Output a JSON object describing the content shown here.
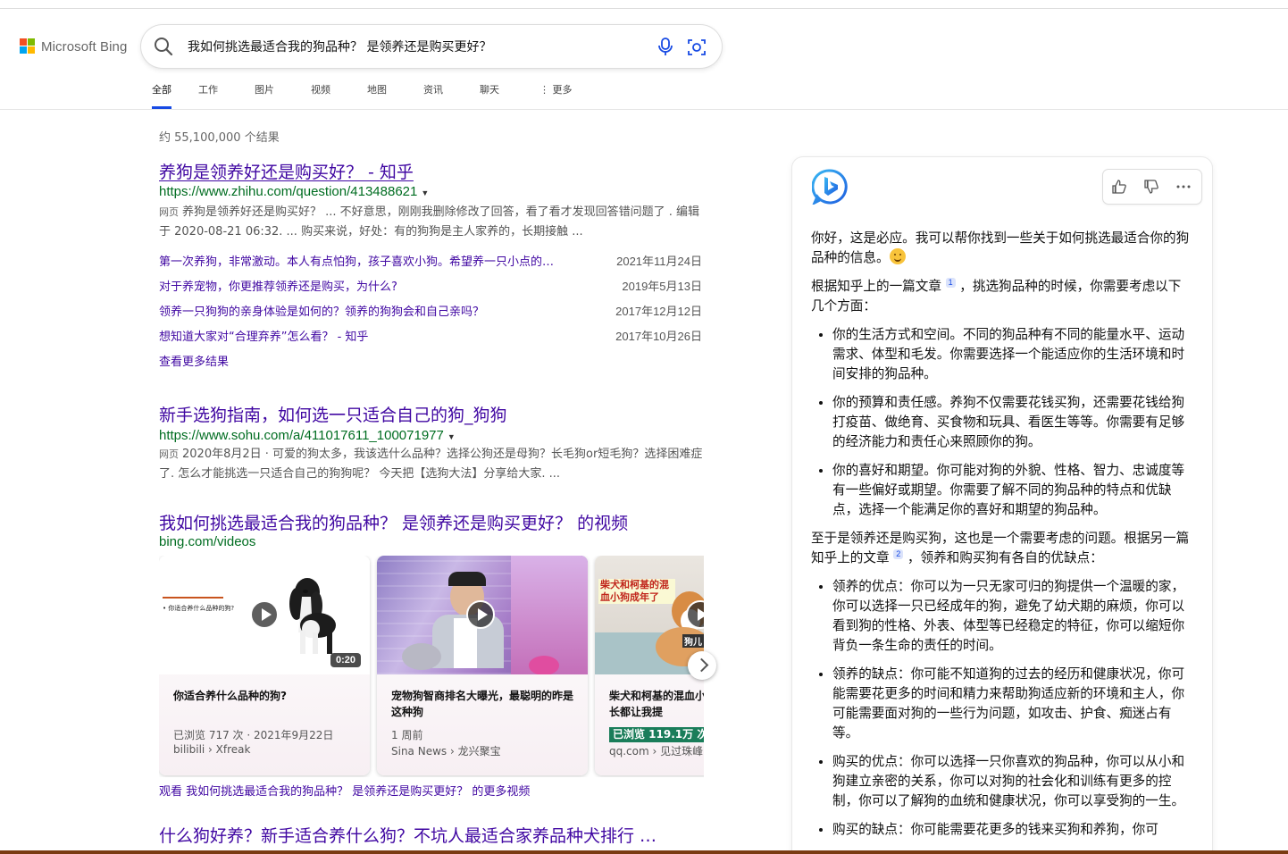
{
  "brand": {
    "name": "Microsoft Bing",
    "colors": [
      "#f25022",
      "#7fba00",
      "#00a4ef",
      "#ffb900"
    ]
  },
  "search": {
    "query": "我如何挑选最适合我的狗品种？ 是领养还是购买更好？",
    "icons": [
      "search-icon",
      "microphone-icon",
      "visual-search-icon"
    ]
  },
  "tabs": [
    {
      "label": "全部",
      "active": true
    },
    {
      "label": "工作"
    },
    {
      "label": "图片"
    },
    {
      "label": "视频"
    },
    {
      "label": "地图"
    },
    {
      "label": "资讯"
    },
    {
      "label": "聊天"
    },
    {
      "label": "⋮ 更多"
    }
  ],
  "results_count": "约 55,100,000 个结果",
  "results": [
    {
      "title": "养狗是领养好还是购买好？ - 知乎",
      "url": "https://www.zhihu.com/question/413488621",
      "label": "网页",
      "snippet": "养狗是领养好还是购买好？ ... 不好意思，刚刚我删除修改了回答，看了看才发现回答错问题了 . 编辑于 2020-08-21 06:32. ... 购买来说，好处：有的狗狗是主人家养的，长期接触 ...",
      "deep_links": [
        {
          "text": "第一次养狗，非常激动。本人有点怕狗，孩子喜欢小狗。希望养一只小点的…",
          "date": "2021年11月24日"
        },
        {
          "text": "对于养宠物，你更推荐领养还是购买，为什么?",
          "date": "2019年5月13日"
        },
        {
          "text": "领养一只狗狗的亲身体验是如何的？领养的狗狗会和自己亲吗？",
          "date": "2017年12月12日"
        },
        {
          "text": "想知道大家对“合理弃养”怎么看？ - 知乎",
          "date": "2017年10月26日"
        }
      ],
      "more": "查看更多结果"
    },
    {
      "title": "新手选狗指南，如何选一只适合自己的狗_狗狗",
      "url": "https://www.sohu.com/a/411017611_100071977",
      "label": "网页",
      "snippet": "2020年8月2日 · 可爱的狗太多，我该选什么品种？选择公狗还是母狗？长毛狗or短毛狗？选择困难症了. 怎么才能挑选一只适合自己的狗狗呢？ 今天把【选狗大法】分享给大家. ..."
    }
  ],
  "videos": {
    "title": "我如何挑选最适合我的狗品种？ 是领养还是购买更好？ 的视频",
    "source": "bing.com/videos",
    "items": [
      {
        "thumb_caption": "• 你适合养什么品种的狗?",
        "duration": "0:20",
        "title": "你适合养什么品种的狗?",
        "meta": "已浏览 717 次 · 2021年9月22日",
        "source": "bilibili › Xfreak"
      },
      {
        "title": "宠物狗智商排名大曝光，最聪明的昨是这种狗",
        "meta": "1 周前",
        "source": "Sina News › 龙兴聚宝"
      },
      {
        "thumb_caption": "柴犬和柯基的混血小狗成年了",
        "thumb_caption2": "狗儿",
        "title": "柴犬和柯基的混血小狗长大了，一次成长都让我提",
        "meta": "已浏览 119.1万 次",
        "source": "qq.com › 见过珠峰"
      }
    ],
    "see_more": "观看 我如何挑选最适合我的狗品种？ 是领养还是购买更好？ 的更多视频"
  },
  "result3_title": "什么狗好养？新手适合养什么狗？不坑人最适合家养品种犬排行 …",
  "chat": {
    "greeting": "你好，这是必应。我可以帮你找到一些关于如何挑选最适合你的狗品种的信息。",
    "intro1_before": "根据知乎上的一篇文章",
    "cite1": "1",
    "intro1_after": "，挑选狗品种的时候，你需要考虑以下几个方面：",
    "points1": [
      "你的生活方式和空间。不同的狗品种有不同的能量水平、运动需求、体型和毛发。你需要选择一个能适应你的生活环境和时间安排的狗品种。",
      "你的预算和责任感。养狗不仅需要花钱买狗，还需要花钱给狗打疫苗、做绝育、买食物和玩具、看医生等等。你需要有足够的经济能力和责任心来照顾你的狗。",
      "你的喜好和期望。你可能对狗的外貌、性格、智力、忠诚度等有一些偏好或期望。你需要了解不同的狗品种的特点和优缺点，选择一个能满足你的喜好和期望的狗品种。"
    ],
    "intro2_before": "至于是领养还是购买狗，这也是一个需要考虑的问题。根据另一篇知乎上的文章",
    "cite2": "2",
    "intro2_after": "，领养和购买狗有各自的优缺点：",
    "points2": [
      "领养的优点：你可以为一只无家可归的狗提供一个温暖的家，你可以选择一只已经成年的狗，避免了幼犬期的麻烦，你可以看到狗的性格、外表、体型等已经稳定的特征，你可以缩短你背负一条生命的责任的时间。",
      "领养的缺点：你可能不知道狗的过去的经历和健康状况，你可能需要花更多的时间和精力来帮助狗适应新的环境和主人，你可能需要面对狗的一些行为问题，如攻击、护食、痴迷占有等。",
      "购买的优点：你可以选择一只你喜欢的狗品种，你可以从小和狗建立亲密的关系，你可以对狗的社会化和训练有更多的控制，你可以了解狗的血统和健康状况，你可以享受狗的一生。",
      "购买的缺点：你可能需要花更多的钱来买狗和养狗，你可"
    ]
  }
}
